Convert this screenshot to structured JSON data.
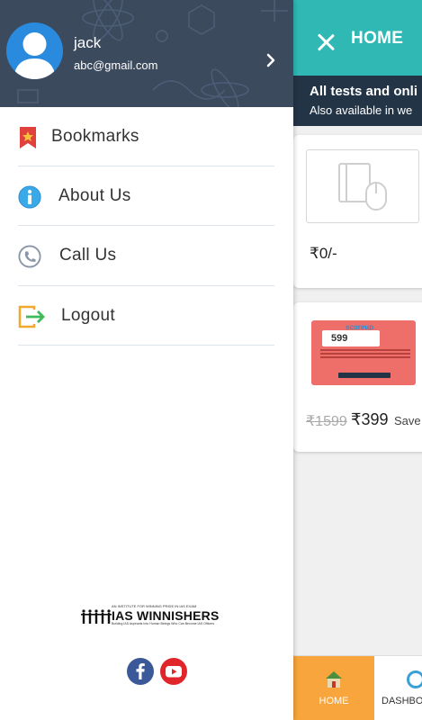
{
  "colors": {
    "header_teal": "#2fb8b4",
    "drawer_header": "#3c4a5e",
    "notice_bar": "#243447",
    "nav_active": "#f7a53c",
    "facebook": "#3b5998",
    "youtube": "#e0262b"
  },
  "app": {
    "title": "HOME",
    "close_icon": "close-icon",
    "notice": {
      "line1": "All tests and onli",
      "line2": "Also available in we"
    },
    "cards": [
      {
        "price": "₹0/-"
      },
      {
        "banner_logo": "scoreup",
        "banner_price": "599",
        "old_price": "₹1599",
        "new_price": "₹399",
        "save_label": "Save"
      }
    ],
    "bottom_nav": [
      {
        "label": "HOME",
        "icon": "house-icon",
        "active": true
      },
      {
        "label": "DASHBO",
        "icon": "dashboard-icon",
        "active": false
      }
    ]
  },
  "drawer": {
    "user": {
      "name": "jack",
      "email": "abc@gmail.com"
    },
    "menu": [
      {
        "label": "Bookmarks",
        "icon": "bookmark-icon"
      },
      {
        "label": "About Us",
        "icon": "info-icon"
      },
      {
        "label": "Call Us",
        "icon": "phone-icon"
      },
      {
        "label": "Logout",
        "icon": "logout-icon"
      }
    ],
    "brand": {
      "tagline": "AN INSTITUTE FOR WINNING PRIDE IN IAS EXAM",
      "name": "IAS WINNISHERS",
      "subline": "Building IAS Aspirants Into Human Beings Who Can Become IAS Officers"
    },
    "social": [
      "facebook-icon",
      "youtube-icon"
    ]
  }
}
